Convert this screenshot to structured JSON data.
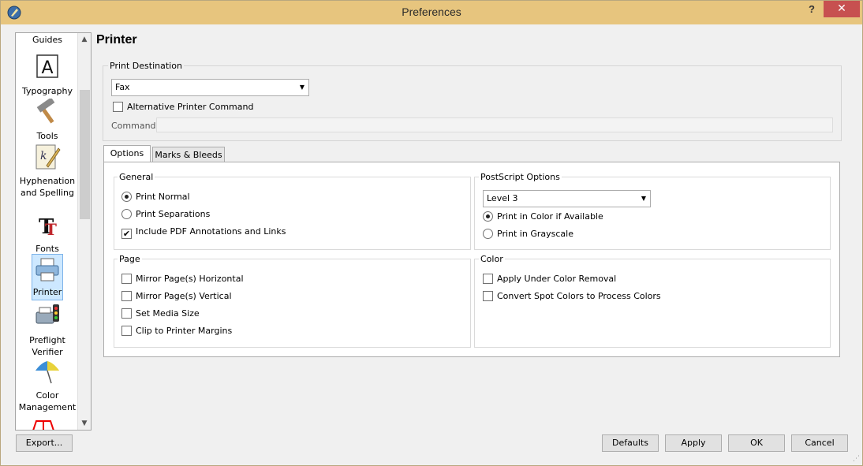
{
  "window": {
    "title": "Preferences",
    "help": "?",
    "close": "✕"
  },
  "sidebar": {
    "items": [
      {
        "label": "Guides"
      },
      {
        "label": "Typography"
      },
      {
        "label": "Tools"
      },
      {
        "label": "Hyphenation and Spelling"
      },
      {
        "label": "Fonts"
      },
      {
        "label": "Printer"
      },
      {
        "label": "Preflight Verifier"
      },
      {
        "label": "Color Management"
      }
    ],
    "selected": "Printer"
  },
  "page": {
    "title": "Printer"
  },
  "destination": {
    "group_label": "Print Destination",
    "printer": "Fax",
    "alt_command_label": "Alternative Printer Command",
    "alt_command_checked": false,
    "command_label": "Command:",
    "command_value": ""
  },
  "tabs": [
    {
      "label": "Options",
      "active": true
    },
    {
      "label": "Marks & Bleeds",
      "active": false
    }
  ],
  "general": {
    "label": "General",
    "print_normal": "Print Normal",
    "print_separations": "Print Separations",
    "include_pdf": "Include PDF Annotations and Links"
  },
  "postscript": {
    "label": "PostScript Options",
    "level": "Level 3",
    "color_if_available": "Print in Color if Available",
    "grayscale": "Print in Grayscale"
  },
  "page_group": {
    "label": "Page",
    "mirror_h": "Mirror Page(s) Horizontal",
    "mirror_v": "Mirror Page(s) Vertical",
    "set_media": "Set Media Size",
    "clip_margins": "Clip to Printer Margins"
  },
  "color_group": {
    "label": "Color",
    "ucr": "Apply Under Color Removal",
    "spot": "Convert Spot Colors to Process Colors"
  },
  "buttons": {
    "export": "Export...",
    "defaults": "Defaults",
    "apply": "Apply",
    "ok": "OK",
    "cancel": "Cancel"
  },
  "colors": {
    "titlebar": "#e7c57e",
    "close": "#c75050",
    "selection": "#cde8ff"
  }
}
